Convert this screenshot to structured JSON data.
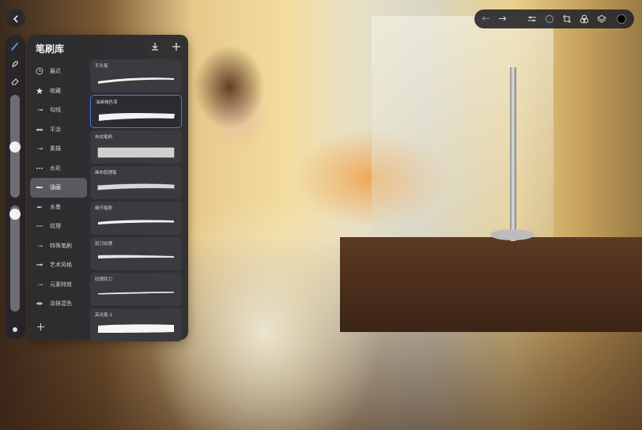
{
  "panel": {
    "title": "笔刷库",
    "categories": [
      {
        "label": "最近",
        "icon": "clock-icon",
        "active": false
      },
      {
        "label": "收藏",
        "icon": "star-icon",
        "active": false
      },
      {
        "label": "勾线",
        "icon": "brush-tip-icon",
        "active": false
      },
      {
        "label": "平涂",
        "icon": "brush-tip-icon",
        "active": false
      },
      {
        "label": "素描",
        "icon": "brush-tip-icon",
        "active": false
      },
      {
        "label": "水彩",
        "icon": "brush-tip-icon",
        "active": false
      },
      {
        "label": "油画",
        "icon": "brush-tip-icon",
        "active": true
      },
      {
        "label": "水墨",
        "icon": "brush-tip-icon",
        "active": false
      },
      {
        "label": "纹理",
        "icon": "brush-tip-icon",
        "active": false
      },
      {
        "label": "特殊笔刷",
        "icon": "brush-tip-icon",
        "active": false
      },
      {
        "label": "艺术风格",
        "icon": "brush-tip-icon",
        "active": false
      },
      {
        "label": "元素特效",
        "icon": "brush-tip-icon",
        "active": false
      },
      {
        "label": "涂抹混色",
        "icon": "brush-tip-icon",
        "active": false
      }
    ],
    "brushes": [
      {
        "name": "平头笔",
        "selected": false
      },
      {
        "name": "油画褐色漆",
        "selected": true
      },
      {
        "name": "布纹笔刷",
        "selected": false
      },
      {
        "name": "画布肌理笔",
        "selected": false
      },
      {
        "name": "细节笔刷",
        "selected": false
      },
      {
        "name": "刮刀纹理",
        "selected": false
      },
      {
        "name": "纹理刮刀",
        "selected": false
      },
      {
        "name": "高光笔-1",
        "selected": false
      }
    ]
  },
  "current_color": "#000000",
  "accent_color": "#4a7bd6"
}
